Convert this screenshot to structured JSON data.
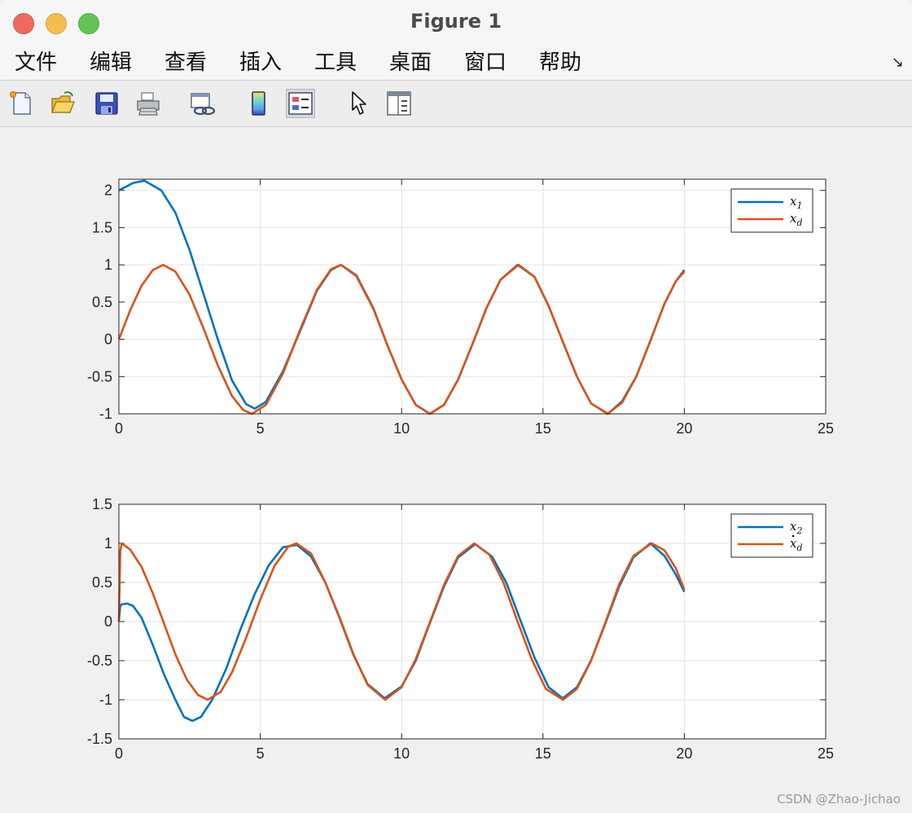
{
  "window": {
    "title": "Figure 1"
  },
  "menu": {
    "items": [
      "文件",
      "编辑",
      "查看",
      "插入",
      "工具",
      "桌面",
      "窗口",
      "帮助"
    ]
  },
  "toolbar": {
    "icons": [
      "new-figure-icon",
      "open-file-icon",
      "save-icon",
      "print-icon",
      "link-plot-icon",
      "colorbar-icon",
      "legend-icon",
      "pointer-icon",
      "property-editor-icon"
    ]
  },
  "colors": {
    "blue": "#0072bd",
    "orange": "#d95319"
  },
  "watermark": "CSDN @Zhao-Jichao",
  "chart_data": [
    {
      "type": "line",
      "title": "",
      "xlabel": "",
      "ylabel": "",
      "xlim": [
        0,
        25
      ],
      "ylim": [
        -1,
        2.15
      ],
      "xticks": [
        0,
        5,
        10,
        15,
        20,
        25
      ],
      "xtick_labels": [
        "0",
        "5",
        "10",
        "15",
        "20",
        "25"
      ],
      "yticks": [
        -1,
        -0.5,
        0,
        0.5,
        1,
        1.5,
        2
      ],
      "ytick_labels": [
        "-1",
        "-0.5",
        "0",
        "0.5",
        "1",
        "1.5",
        "2"
      ],
      "grid": true,
      "legend_position": "top-right",
      "series": [
        {
          "name": "x_1",
          "color": "#0072bd",
          "x": [
            0,
            0.5,
            0.9,
            1.5,
            2.0,
            2.5,
            3.0,
            3.5,
            4.0,
            4.5,
            4.8,
            5.2,
            5.8,
            6.4,
            7.0,
            7.5,
            7.85,
            8.4,
            9.0,
            9.5,
            10.0,
            10.5,
            11.0,
            11.5,
            12.0,
            12.5,
            13.0,
            13.5,
            14.1,
            14.7,
            15.2,
            15.7,
            16.2,
            16.7,
            17.3,
            17.8,
            18.3,
            18.8,
            19.3,
            19.7,
            20.0
          ],
          "y": [
            2.0,
            2.1,
            2.13,
            2.0,
            1.7,
            1.2,
            0.6,
            0.0,
            -0.55,
            -0.87,
            -0.93,
            -0.84,
            -0.43,
            0.1,
            0.65,
            0.93,
            1.0,
            0.86,
            0.42,
            -0.08,
            -0.54,
            -0.88,
            -1.0,
            -0.88,
            -0.54,
            -0.07,
            0.42,
            0.8,
            1.0,
            0.84,
            0.45,
            -0.03,
            -0.5,
            -0.86,
            -1.0,
            -0.83,
            -0.5,
            -0.02,
            0.48,
            0.78,
            0.93
          ]
        },
        {
          "name": "x_d",
          "color": "#d95319",
          "x": [
            0,
            0.4,
            0.8,
            1.2,
            1.57,
            2.0,
            2.5,
            3.0,
            3.5,
            4.0,
            4.4,
            4.71,
            5.2,
            5.8,
            6.4,
            7.0,
            7.5,
            7.85,
            8.4,
            9.0,
            9.5,
            10.0,
            10.5,
            11.0,
            11.5,
            12.0,
            12.5,
            13.0,
            13.5,
            14.14,
            14.7,
            15.2,
            15.7,
            16.2,
            16.7,
            17.28,
            17.8,
            18.3,
            18.8,
            19.3,
            19.7,
            20.0
          ],
          "y": [
            0.0,
            0.39,
            0.72,
            0.93,
            1.0,
            0.91,
            0.6,
            0.14,
            -0.35,
            -0.76,
            -0.95,
            -1.0,
            -0.88,
            -0.46,
            0.12,
            0.66,
            0.94,
            1.0,
            0.85,
            0.41,
            -0.08,
            -0.54,
            -0.88,
            -1.0,
            -0.88,
            -0.54,
            -0.07,
            0.42,
            0.8,
            1.0,
            0.84,
            0.45,
            -0.03,
            -0.5,
            -0.86,
            -1.0,
            -0.85,
            -0.5,
            -0.02,
            0.48,
            0.78,
            0.91
          ]
        }
      ]
    },
    {
      "type": "line",
      "title": "",
      "xlabel": "",
      "ylabel": "",
      "xlim": [
        0,
        25
      ],
      "ylim": [
        -1.5,
        1.5
      ],
      "xticks": [
        0,
        5,
        10,
        15,
        20,
        25
      ],
      "xtick_labels": [
        "0",
        "5",
        "10",
        "15",
        "20",
        "25"
      ],
      "yticks": [
        -1.5,
        -1,
        -0.5,
        0,
        0.5,
        1,
        1.5
      ],
      "ytick_labels": [
        "-1.5",
        "-1",
        "-0.5",
        "0",
        "0.5",
        "1",
        "1.5"
      ],
      "grid": true,
      "legend_position": "top-right",
      "series": [
        {
          "name": "x_2",
          "color": "#0072bd",
          "x": [
            0,
            0.05,
            0.1,
            0.3,
            0.5,
            0.8,
            1.2,
            1.6,
            2.0,
            2.3,
            2.6,
            2.9,
            3.3,
            3.8,
            4.3,
            4.8,
            5.3,
            5.8,
            6.3,
            6.8,
            7.3,
            7.8,
            8.3,
            8.8,
            9.4,
            10.0,
            10.5,
            11.0,
            11.5,
            12.0,
            12.6,
            13.2,
            13.7,
            14.2,
            14.7,
            15.2,
            15.7,
            16.2,
            16.7,
            17.2,
            17.7,
            18.2,
            18.8,
            19.3,
            19.7,
            20.0
          ],
          "y": [
            0.0,
            0.2,
            0.22,
            0.23,
            0.2,
            0.05,
            -0.3,
            -0.68,
            -1.0,
            -1.22,
            -1.27,
            -1.22,
            -1.0,
            -0.6,
            -0.1,
            0.35,
            0.72,
            0.95,
            0.98,
            0.83,
            0.5,
            0.05,
            -0.43,
            -0.8,
            -0.98,
            -0.83,
            -0.5,
            -0.02,
            0.45,
            0.82,
            0.99,
            0.83,
            0.5,
            0.02,
            -0.46,
            -0.84,
            -0.98,
            -0.84,
            -0.5,
            -0.03,
            0.45,
            0.82,
            1.0,
            0.84,
            0.6,
            0.38
          ]
        },
        {
          "name": "x_d_dot",
          "color": "#d95319",
          "x": [
            0,
            0.05,
            0.1,
            0.4,
            0.8,
            1.2,
            1.6,
            2.0,
            2.4,
            2.8,
            3.14,
            3.6,
            4.0,
            4.5,
            5.0,
            5.5,
            6.0,
            6.28,
            6.8,
            7.3,
            7.8,
            8.3,
            8.8,
            9.42,
            10.0,
            10.5,
            11.0,
            11.5,
            12.0,
            12.57,
            13.1,
            13.6,
            14.1,
            14.6,
            15.1,
            15.71,
            16.2,
            16.7,
            17.2,
            17.7,
            18.2,
            18.85,
            19.3,
            19.7,
            20.0
          ],
          "y": [
            0.0,
            0.9,
            1.0,
            0.92,
            0.7,
            0.36,
            -0.03,
            -0.42,
            -0.74,
            -0.94,
            -1.0,
            -0.9,
            -0.65,
            -0.21,
            0.28,
            0.71,
            0.96,
            1.0,
            0.87,
            0.5,
            0.06,
            -0.42,
            -0.81,
            -1.0,
            -0.84,
            -0.48,
            -0.01,
            0.47,
            0.84,
            1.0,
            0.86,
            0.5,
            0.0,
            -0.48,
            -0.86,
            -1.0,
            -0.86,
            -0.5,
            -0.02,
            0.48,
            0.84,
            1.0,
            0.91,
            0.68,
            0.41
          ]
        }
      ]
    }
  ]
}
